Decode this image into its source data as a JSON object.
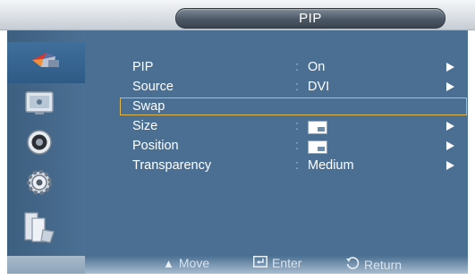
{
  "window": {
    "title": "PIP"
  },
  "sidebar": {
    "items": [
      {
        "name": "picture-icon",
        "active": true
      },
      {
        "name": "input-source-icon",
        "active": false
      },
      {
        "name": "sound-icon",
        "active": false
      },
      {
        "name": "setup-icon",
        "active": false
      },
      {
        "name": "multi-control-icon",
        "active": false
      }
    ]
  },
  "menu": {
    "items": [
      {
        "label": "PIP",
        "separator": ":",
        "value": "On",
        "has_arrow": true
      },
      {
        "label": "Source",
        "separator": ":",
        "value": "DVI",
        "has_arrow": true
      },
      {
        "label": "Swap",
        "separator": "",
        "value": "",
        "has_arrow": false,
        "selected": true
      },
      {
        "label": "Size",
        "separator": ":",
        "value": "",
        "has_arrow": true,
        "thumbnail": "size-thumbnail-icon"
      },
      {
        "label": "Position",
        "separator": ":",
        "value": "",
        "has_arrow": true,
        "thumbnail": "position-thumbnail-icon"
      },
      {
        "label": "Transparency",
        "separator": ":",
        "value": "Medium",
        "has_arrow": true
      }
    ]
  },
  "footer": {
    "move_label": "Move",
    "enter_label": "Enter",
    "return_label": "Return"
  },
  "colors": {
    "panel": "#4a6f92",
    "selection_border": "#e2b64a",
    "title_pill": "#4c5865"
  }
}
